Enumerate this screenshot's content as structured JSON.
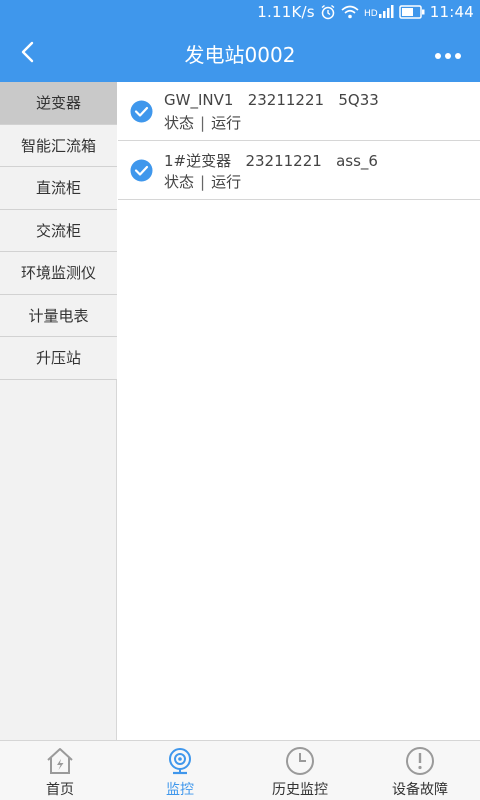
{
  "colors": {
    "primary": "#3f97ec",
    "sidebar_bg": "#f2f2f2",
    "sidebar_active": "#c9c9c9",
    "tab_inactive": "#9a9a9a"
  },
  "statusbar": {
    "speed": "1.11K/s",
    "time": "11:44",
    "icons": [
      "alarm-icon",
      "wifi-icon",
      "hd-signal-icon",
      "battery-icon"
    ]
  },
  "navbar": {
    "title": "发电站0002",
    "back_icon": "chevron-left-icon",
    "more_icon": "more-dots-icon"
  },
  "sidebar": {
    "active_index": 0,
    "items": [
      {
        "label": "逆变器"
      },
      {
        "label": "智能汇流箱"
      },
      {
        "label": "直流柜"
      },
      {
        "label": "交流柜"
      },
      {
        "label": "环境监测仪"
      },
      {
        "label": "计量电表"
      },
      {
        "label": "升压站"
      }
    ]
  },
  "devices": [
    {
      "name": "GW_INV1",
      "code": "23211221",
      "id": "5Q33",
      "status_label": "状态",
      "status_value": "运行"
    },
    {
      "name": "1#逆变器",
      "code": "23211221",
      "id": "ass_6",
      "status_label": "状态",
      "status_value": "运行"
    }
  ],
  "tabs": {
    "active_index": 1,
    "items": [
      {
        "label": "首页",
        "icon": "home-icon"
      },
      {
        "label": "监控",
        "icon": "camera-icon"
      },
      {
        "label": "历史监控",
        "icon": "clock-icon"
      },
      {
        "label": "设备故障",
        "icon": "alert-icon"
      }
    ]
  }
}
